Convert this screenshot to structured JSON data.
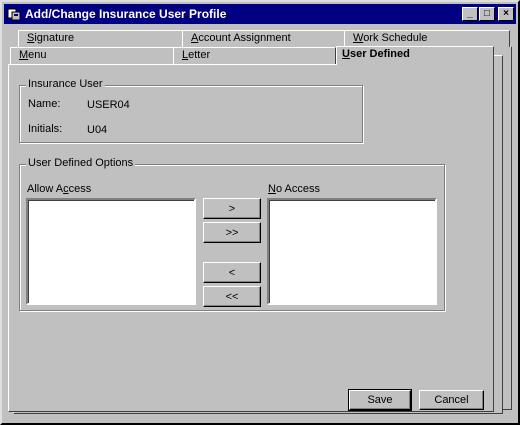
{
  "window": {
    "title": "Add/Change Insurance User Profile",
    "controls": {
      "minimize": "_",
      "maximize": "□",
      "close": "×"
    }
  },
  "tabs": {
    "row_back": [
      {
        "pre": "",
        "key": "S",
        "post": "ignature"
      },
      {
        "pre": "",
        "key": "A",
        "post": "ccount Assignment"
      },
      {
        "pre": "",
        "key": "W",
        "post": "ork Schedule"
      }
    ],
    "row_front": [
      {
        "pre": "",
        "key": "M",
        "post": "enu"
      },
      {
        "pre": "",
        "key": "L",
        "post": "etter"
      },
      {
        "pre": "",
        "key": "U",
        "post": "ser Defined"
      }
    ]
  },
  "insurance_user": {
    "legend": "Insurance User",
    "name_label": "Name:",
    "name_value": "USER04",
    "initials_label": "Initials:",
    "initials_value": "U04"
  },
  "user_defined_options": {
    "legend": "User Defined Options",
    "allow_access_pre": "Allow A",
    "allow_access_key": "c",
    "allow_access_post": "cess",
    "no_access_pre": "",
    "no_access_key": "N",
    "no_access_post": "o Access",
    "allow_items": [],
    "no_items": []
  },
  "move_buttons": {
    "move_one_right": ">",
    "move_all_right": ">>",
    "move_one_left": "<",
    "move_all_left": "<<"
  },
  "footer": {
    "save": "Save",
    "cancel": "Cancel"
  }
}
